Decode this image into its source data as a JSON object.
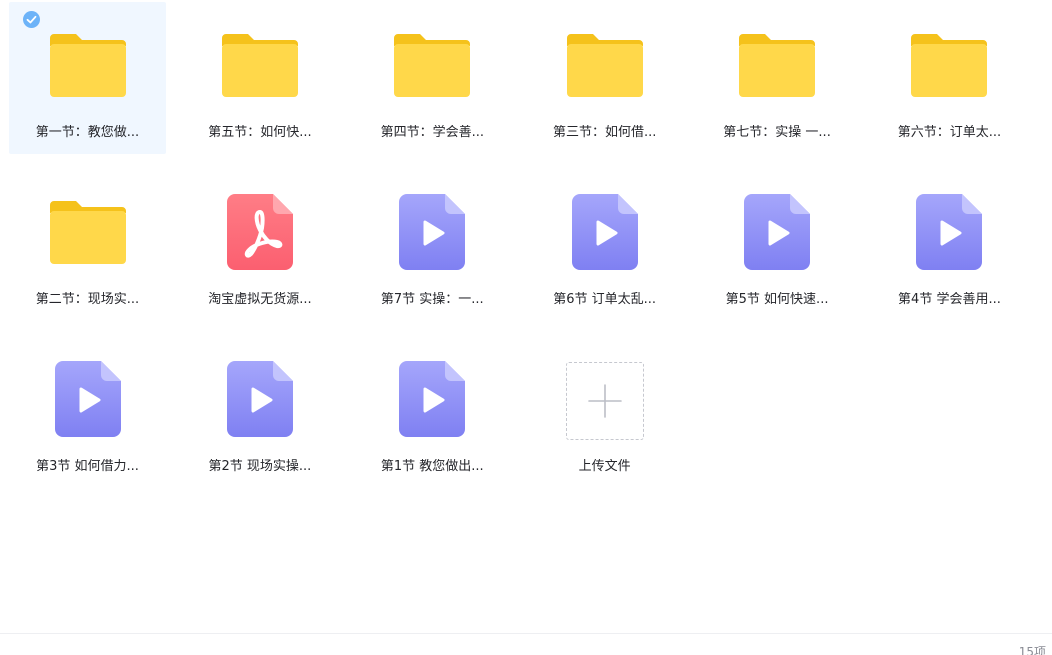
{
  "files": [
    {
      "name": "第一节：教您做...",
      "type": "folder",
      "selected": true
    },
    {
      "name": "第五节：如何快...",
      "type": "folder",
      "selected": false
    },
    {
      "name": "第四节：学会善...",
      "type": "folder",
      "selected": false
    },
    {
      "name": "第三节：如何借...",
      "type": "folder",
      "selected": false
    },
    {
      "name": "第七节：实操 一...",
      "type": "folder",
      "selected": false
    },
    {
      "name": "第六节：订单太...",
      "type": "folder",
      "selected": false
    },
    {
      "name": "第二节：现场实...",
      "type": "folder",
      "selected": false
    },
    {
      "name": "淘宝虚拟无货源...",
      "type": "pdf",
      "selected": false
    },
    {
      "name": "第7节  实操：一...",
      "type": "video",
      "selected": false
    },
    {
      "name": "第6节  订单太乱...",
      "type": "video",
      "selected": false
    },
    {
      "name": "第5节  如何快速...",
      "type": "video",
      "selected": false
    },
    {
      "name": "第4节  学会善用...",
      "type": "video",
      "selected": false
    },
    {
      "name": "第3节  如何借力...",
      "type": "video",
      "selected": false
    },
    {
      "name": "第2节  现场实操...",
      "type": "video",
      "selected": false
    },
    {
      "name": "第1节  教您做出...",
      "type": "video",
      "selected": false
    }
  ],
  "upload": {
    "label": "上传文件"
  },
  "footer": {
    "count": "15项"
  },
  "colors": {
    "folder": "#ffd84a",
    "folder_tab": "#f5c21b",
    "pdf": "#ff6f7d",
    "video": "#8b8cf6",
    "selected_bg": "#f0f7ff",
    "check": "#6db3f8"
  },
  "icons": {
    "folder": "folder-icon",
    "pdf": "pdf-file-icon",
    "video": "video-file-icon",
    "upload": "plus-icon",
    "selected": "check-circle-icon"
  }
}
